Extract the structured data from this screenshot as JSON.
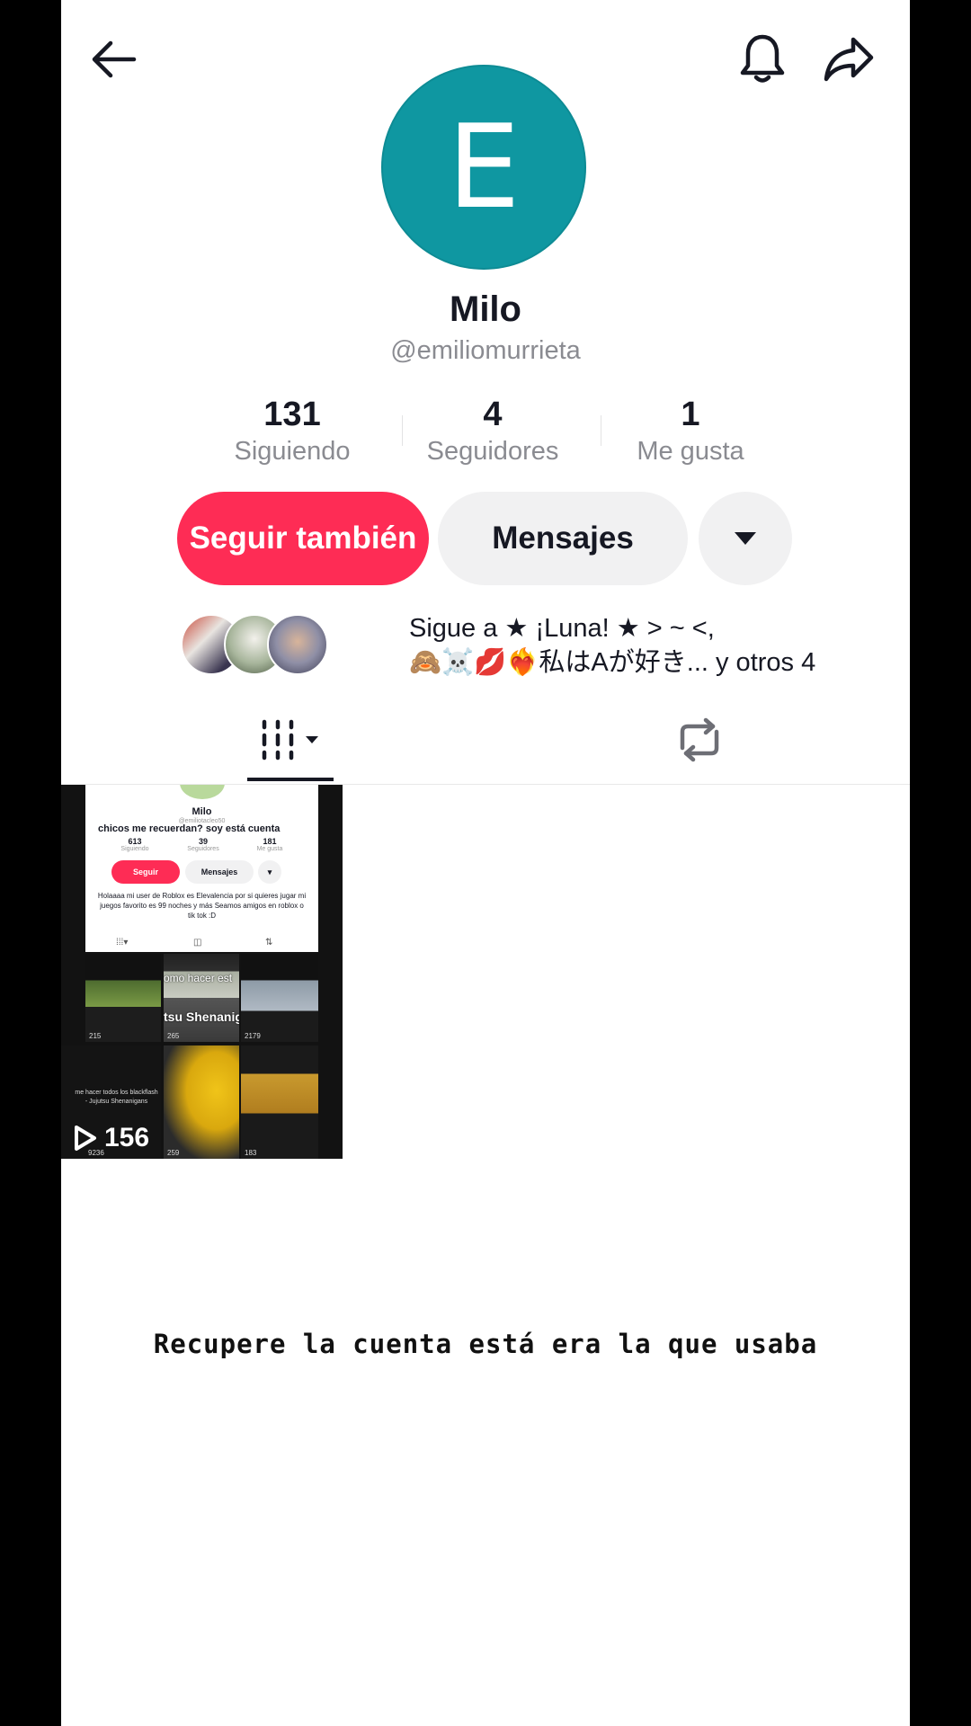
{
  "profile": {
    "avatar_letter": "E",
    "name": "Milo",
    "handle": "@emiliomurrieta",
    "avatar_color": "#0f97a1"
  },
  "stats": [
    {
      "value": "131",
      "label": "Siguiendo"
    },
    {
      "value": "4",
      "label": "Seguidores"
    },
    {
      "value": "1",
      "label": "Me gusta"
    }
  ],
  "actions": {
    "follow_label": "Seguir también",
    "message_label": "Mensajes",
    "follow_color": "#fe2c55"
  },
  "suggested": {
    "line1": "Sigue a ★ ¡Luna! ★ > ~ <,",
    "line2": "🙈☠️💋❤️‍🔥私はAが好き... y otros 4"
  },
  "tabs": [
    {
      "icon": "grid-icon"
    },
    {
      "icon": "repost-icon"
    }
  ],
  "video_thumb": {
    "views": "156",
    "mini_profile": {
      "name": "Milo",
      "handle": "@emiliotacleo50",
      "caption": "chicos me recuerdan? soy está cuenta",
      "stats": [
        {
          "value": "613",
          "label": "Siguiendo"
        },
        {
          "value": "39",
          "label": "Seguidores"
        },
        {
          "value": "181",
          "label": "Me gusta"
        }
      ],
      "follow_label": "Seguir",
      "message_label": "Mensajes",
      "bio": "Holaaaa mi user de Roblox es Elevalencia por si quieres jugar mi juegos favorito es 99 noches y más Seamos amigos en roblox o tik tok :D"
    },
    "grid": {
      "overlay1": "omo hacer est",
      "overlay2": "tsu Shenanig",
      "small_caption": "me hacer todos los blackflash - Jujutsu Shenanigans",
      "counts": [
        "215",
        "265",
        "2179",
        "9236",
        "259",
        "183"
      ]
    }
  },
  "caption": "Recupere la cuenta está era la que usaba"
}
